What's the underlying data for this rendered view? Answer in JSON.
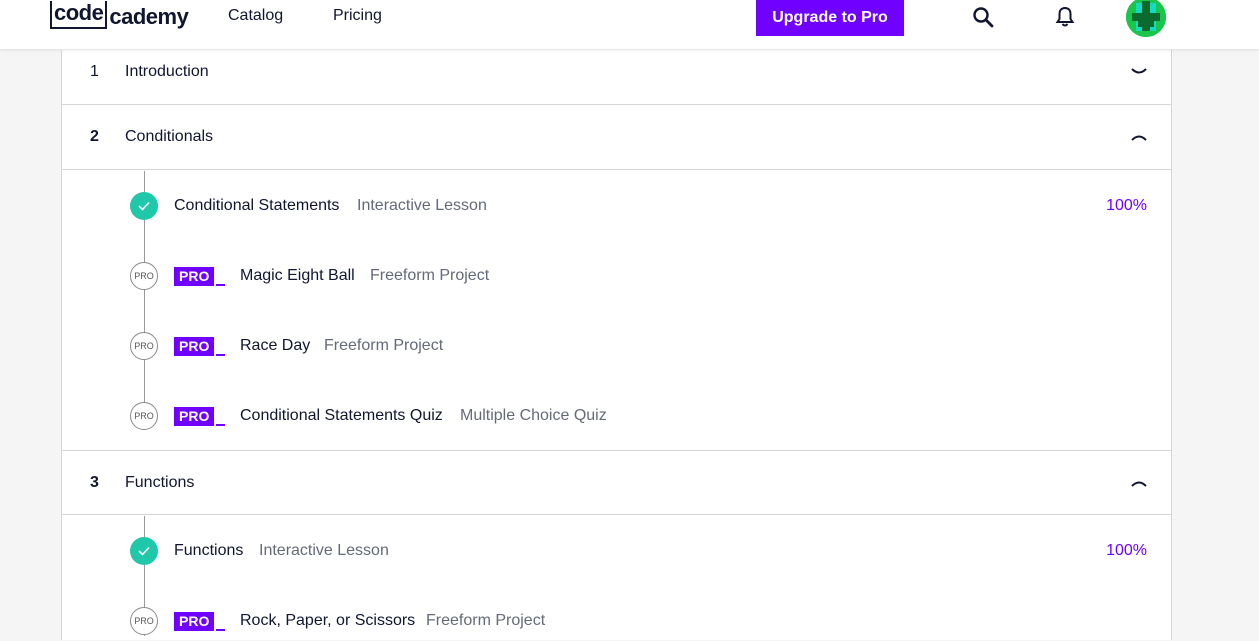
{
  "header": {
    "logo_box": "code",
    "logo_rest": "cademy",
    "nav": [
      "Catalog",
      "Pricing"
    ],
    "upgrade_label": "Upgrade to Pro",
    "accent": "#7000ff"
  },
  "modules": [
    {
      "num": "1",
      "title": "Introduction",
      "expanded": false
    },
    {
      "num": "2",
      "title": "Conditionals",
      "expanded": true,
      "items": [
        {
          "status": "complete",
          "title": "Conditional Statements",
          "type": "Interactive Lesson",
          "progress": "100%"
        },
        {
          "status": "pro",
          "pro_circle": "PRO",
          "pro_badge": "PRO",
          "title": "Magic Eight Ball",
          "type": "Freeform Project"
        },
        {
          "status": "pro",
          "pro_circle": "PRO",
          "pro_badge": "PRO",
          "title": "Race Day",
          "type": "Freeform Project"
        },
        {
          "status": "pro",
          "pro_circle": "PRO",
          "pro_badge": "PRO",
          "title": "Conditional Statements Quiz",
          "type": "Multiple Choice Quiz"
        }
      ]
    },
    {
      "num": "3",
      "title": "Functions",
      "expanded": true,
      "items": [
        {
          "status": "complete",
          "title": "Functions",
          "type": "Interactive Lesson",
          "progress": "100%"
        },
        {
          "status": "pro",
          "pro_circle": "PRO",
          "pro_badge": "PRO",
          "title": "Rock, Paper, or Scissors",
          "type": "Freeform Project"
        }
      ]
    }
  ],
  "colors": {
    "complete": "#1fc8a9",
    "pro": "#7000ff"
  }
}
